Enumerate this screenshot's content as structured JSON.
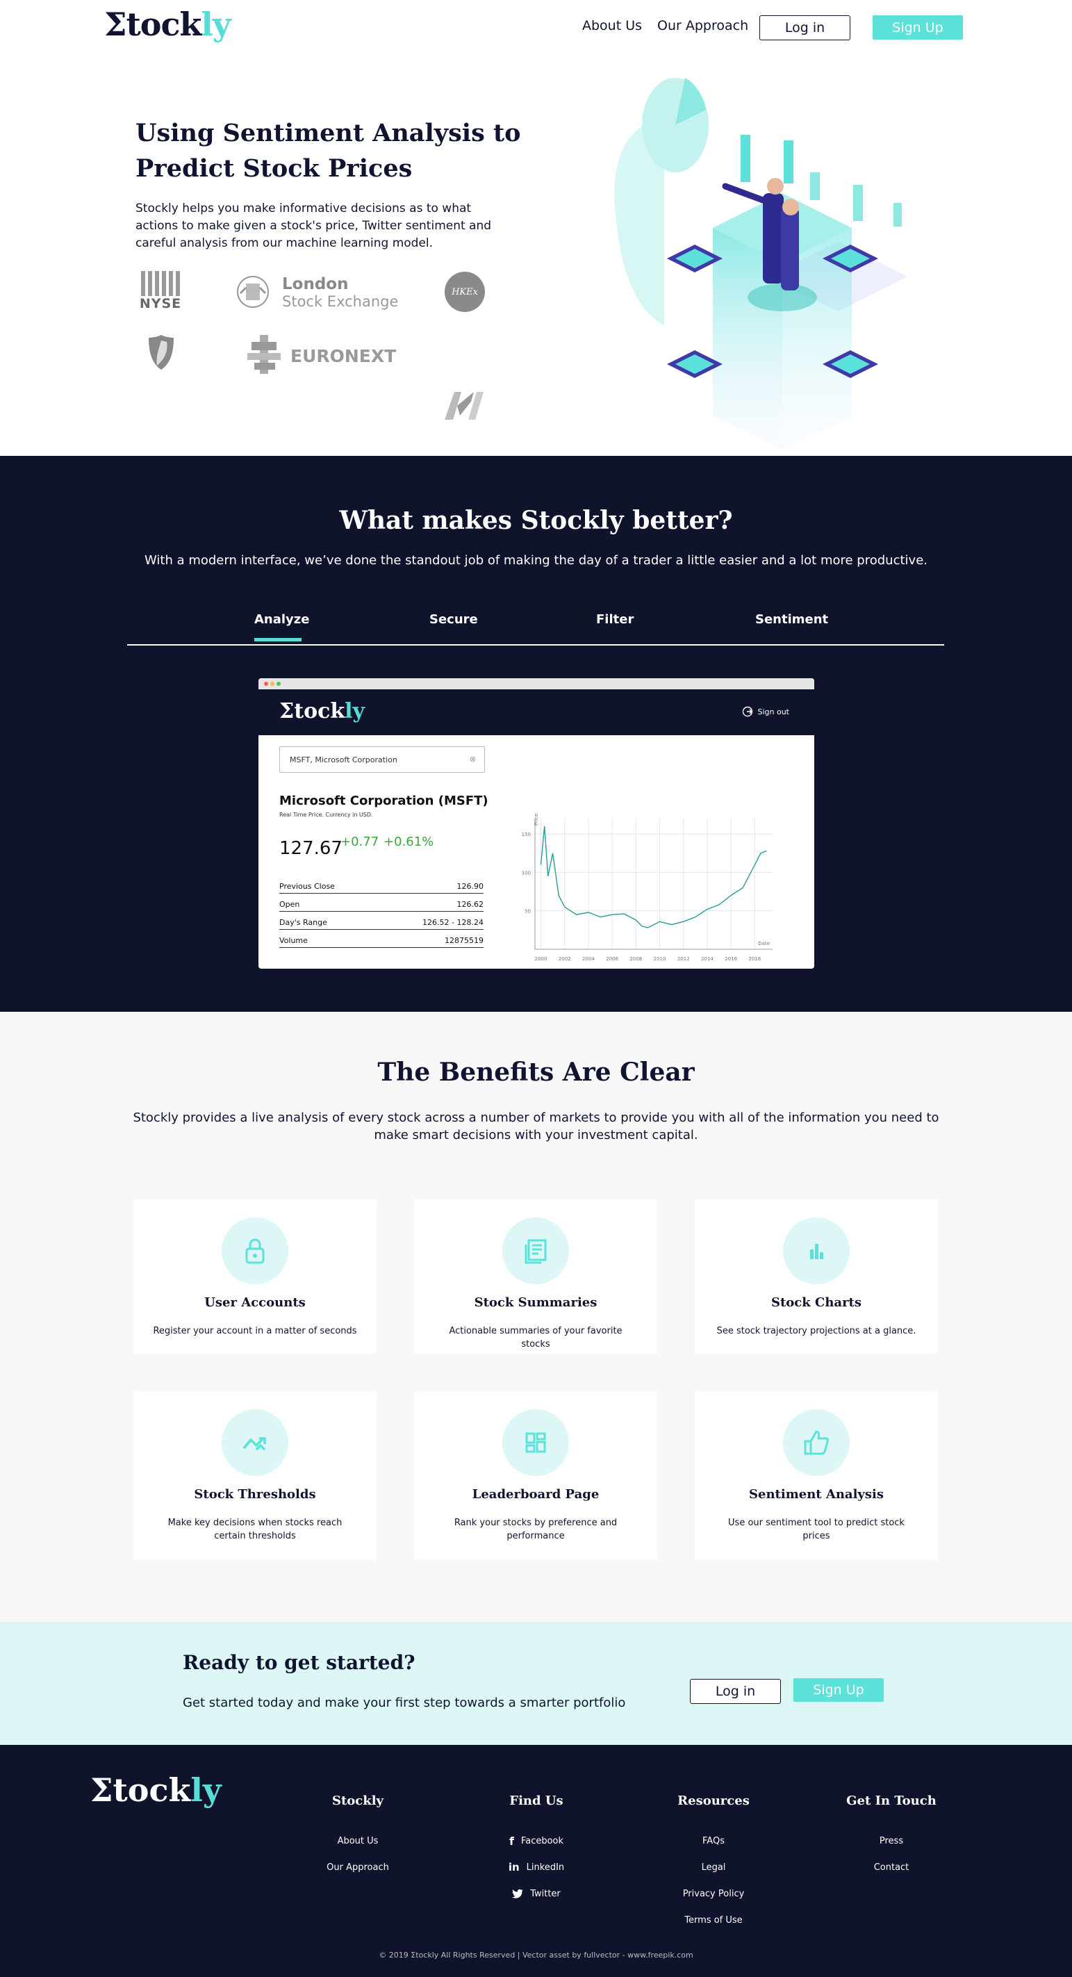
{
  "brand": {
    "logo_main": "Σtock",
    "logo_accent": "ly",
    "accent_color": "#5ce1db",
    "dark_color": "#0f132b"
  },
  "nav": {
    "about": "About Us",
    "approach": "Our Approach",
    "login": "Log in",
    "signup": "Sign Up"
  },
  "hero": {
    "title": "Using Sentiment Analysis to Predict Stock Prices",
    "description": "Stockly helps you make informative decisions as to what actions to make given a stock's price, Twitter sentiment and careful analysis from our machine learning model.",
    "exchanges": {
      "nyse": "NYSE",
      "lse_line1": "London",
      "lse_line2": "Stock Exchange",
      "hkex": "HKEx",
      "euronext": "EURONEXT"
    }
  },
  "features": {
    "title": "What makes Stockly better?",
    "subtitle": "With a modern interface, we’ve done the standout job of making the day of a trader a little easier and a lot more productive.",
    "tabs": [
      "Analyze",
      "Secure",
      "Filter",
      "Sentiment"
    ],
    "active_tab": "Analyze"
  },
  "mockup": {
    "signout": "Sign out",
    "search_value": "MSFT, Microsoft Corporation",
    "search_clear": "⊗",
    "company": "Microsoft Corporation (MSFT)",
    "company_sub": "Real Time Price. Currency in USD.",
    "price": "127.67",
    "change_abs": "+0.77",
    "change_pct": "+0.61%",
    "stats": [
      {
        "label": "Previous Close",
        "value": "126.90"
      },
      {
        "label": "Open",
        "value": "126.62"
      },
      {
        "label": "Day's Range",
        "value": "126.52 - 128.24"
      },
      {
        "label": "Volume",
        "value": "12875519"
      }
    ],
    "chart_y_label": "Price",
    "chart_x_label": "Date",
    "chart_y_ticks": [
      "150",
      "100",
      "50"
    ],
    "chart_x_ticks": [
      "2000",
      "2002",
      "2004",
      "2006",
      "2008",
      "2010",
      "2012",
      "2014",
      "2016",
      "2018"
    ]
  },
  "chart_data": {
    "type": "line",
    "x": [
      2000,
      2000.3,
      2000.6,
      2001,
      2001.5,
      2002,
      2002.5,
      2003,
      2004,
      2005,
      2006,
      2007,
      2008,
      2008.5,
      2009,
      2010,
      2011,
      2012,
      2013,
      2014,
      2015,
      2016,
      2017,
      2017.5,
      2018,
      2018.5,
      2019
    ],
    "series": [
      {
        "values": [
          110,
          160,
          95,
          125,
          70,
          55,
          50,
          45,
          48,
          42,
          45,
          46,
          38,
          30,
          28,
          36,
          32,
          36,
          42,
          52,
          58,
          70,
          80,
          95,
          110,
          125,
          128
        ]
      }
    ],
    "xlabel": "Date",
    "ylabel": "Price",
    "ylim": [
      0,
      170
    ],
    "xlim": [
      1999.5,
      2019.5
    ],
    "grid": true
  },
  "benefits": {
    "title": "The Benefits Are Clear",
    "subtitle": "Stockly provides a live analysis of every stock across a number of markets to provide you with all of the information you need to make smart decisions with your investment capital.",
    "cards": [
      {
        "icon": "lock-icon",
        "title": "User Accounts",
        "text": "Register your account in a matter of seconds"
      },
      {
        "icon": "newspaper-icon",
        "title": "Stock Summaries",
        "text": "Actionable summaries of your favorite stocks"
      },
      {
        "icon": "bar-chart-icon",
        "title": "Stock Charts",
        "text": "See stock trajectory projections at a glance."
      },
      {
        "icon": "trend-icon",
        "title": "Stock Thresholds",
        "text": "Make key decisions when stocks reach certain thresholds"
      },
      {
        "icon": "dashboard-icon",
        "title": "Leaderboard Page",
        "text": "Rank your stocks by preference and performance"
      },
      {
        "icon": "thumbs-up-icon",
        "title": "Sentiment Analysis",
        "text": "Use our sentiment tool to predict stock prices"
      }
    ]
  },
  "cta": {
    "title": "Ready to get started?",
    "text": "Get started today and make your first step towards a smarter portfolio",
    "login": "Log in",
    "signup": "Sign Up"
  },
  "footer": {
    "columns": [
      {
        "title": "Stockly",
        "links": [
          "About Us",
          "Our Approach"
        ]
      },
      {
        "title": "Find Us",
        "links": [
          "Facebook",
          "LinkedIn",
          "Twitter"
        ]
      },
      {
        "title": "Resources",
        "links": [
          "FAQs",
          "Legal",
          "Privacy Policy",
          "Terms of Use"
        ]
      },
      {
        "title": "Get In Touch",
        "links": [
          "Press",
          "Contact"
        ]
      }
    ],
    "copyright": "© 2019 Σtockly All Rights Reserved | Vector asset by fullvector - www.freepik.com"
  }
}
